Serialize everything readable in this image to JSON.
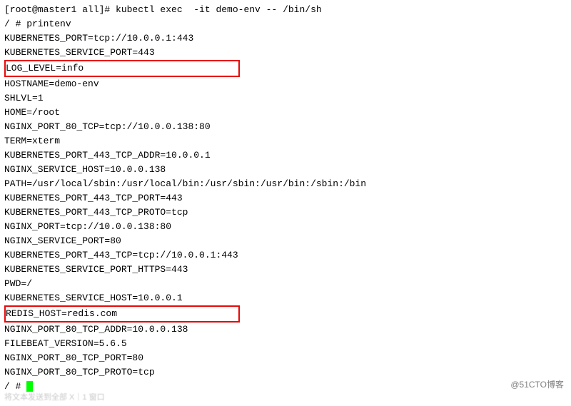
{
  "terminal": {
    "prompt_line": "[root@master1 all]# kubectl exec  -it demo-env -- /bin/sh",
    "printenv_line": "/ # printenv",
    "env_lines": [
      "KUBERNETES_PORT=tcp://10.0.0.1:443",
      "KUBERNETES_SERVICE_PORT=443"
    ],
    "highlighted_1": "LOG_LEVEL=info",
    "env_lines_2": [
      "HOSTNAME=demo-env",
      "SHLVL=1",
      "HOME=/root",
      "NGINX_PORT_80_TCP=tcp://10.0.0.138:80",
      "TERM=xterm",
      "KUBERNETES_PORT_443_TCP_ADDR=10.0.0.1",
      "NGINX_SERVICE_HOST=10.0.0.138",
      "PATH=/usr/local/sbin:/usr/local/bin:/usr/sbin:/usr/bin:/sbin:/bin",
      "KUBERNETES_PORT_443_TCP_PORT=443",
      "KUBERNETES_PORT_443_TCP_PROTO=tcp",
      "NGINX_PORT=tcp://10.0.0.138:80",
      "NGINX_SERVICE_PORT=80",
      "KUBERNETES_PORT_443_TCP=tcp://10.0.0.1:443",
      "KUBERNETES_SERVICE_PORT_HTTPS=443",
      "PWD=/",
      "KUBERNETES_SERVICE_HOST=10.0.0.1"
    ],
    "highlighted_2": "REDIS_HOST=redis.com",
    "env_lines_3": [
      "NGINX_PORT_80_TCP_ADDR=10.0.0.138",
      "FILEBEAT_VERSION=5.6.5",
      "NGINX_PORT_80_TCP_PORT=80",
      "NGINX_PORT_80_TCP_PROTO=tcp"
    ],
    "final_prompt": "/ # "
  },
  "watermark": "@51CTO博客",
  "footer": "将文本发送到全部 X｜1 窗口"
}
